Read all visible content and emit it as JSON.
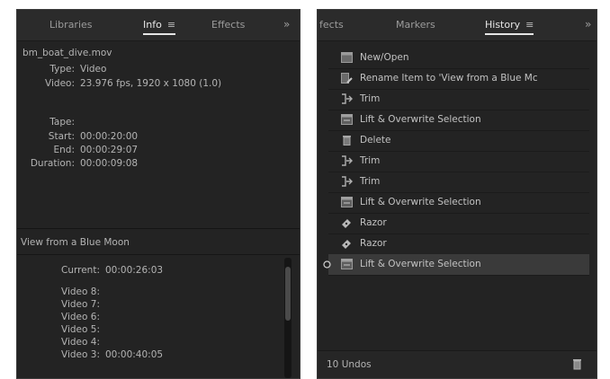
{
  "info_panel": {
    "tabs": [
      {
        "label": "Libraries"
      },
      {
        "label": "Info"
      },
      {
        "label": "Effects"
      }
    ],
    "overflow_glyph": "»",
    "menu_glyph": "≡",
    "clip_name": "bm_boat_dive.mov",
    "clip_fields": [
      {
        "label": "Type:",
        "value": "Video"
      },
      {
        "label": "Video:",
        "value": "23.976 fps, 1920 x 1080 (1.0)"
      }
    ],
    "timing_fields": [
      {
        "label": "Tape:",
        "value": ""
      },
      {
        "label": "Start:",
        "value": "00:00:20:00"
      },
      {
        "label": "End:",
        "value": "00:00:29:07"
      },
      {
        "label": "Duration:",
        "value": "00:00:09:08"
      }
    ],
    "sequence_name": "View from a Blue Moon",
    "current": {
      "label": "Current:",
      "value": "00:00:26:03"
    },
    "video_tracks": [
      {
        "label": "Video 8:",
        "value": ""
      },
      {
        "label": "Video 7:",
        "value": ""
      },
      {
        "label": "Video 6:",
        "value": ""
      },
      {
        "label": "Video 5:",
        "value": ""
      },
      {
        "label": "Video 4:",
        "value": ""
      },
      {
        "label": "Video 3:",
        "value": "00:00:40:05"
      }
    ]
  },
  "history_panel": {
    "tabs": [
      {
        "label": "fects"
      },
      {
        "label": "Markers"
      },
      {
        "label": "History"
      }
    ],
    "overflow_glyph": "»",
    "menu_glyph": "≡",
    "items": [
      {
        "label": "New/Open",
        "icon": "new-open-icon"
      },
      {
        "label": "Rename Item to 'View from a Blue Mc",
        "icon": "rename-icon"
      },
      {
        "label": "Trim",
        "icon": "trim-icon"
      },
      {
        "label": "Lift & Overwrite Selection",
        "icon": "lift-overwrite-icon"
      },
      {
        "label": "Delete",
        "icon": "delete-icon"
      },
      {
        "label": "Trim",
        "icon": "trim-icon"
      },
      {
        "label": "Trim",
        "icon": "trim-icon"
      },
      {
        "label": "Lift & Overwrite Selection",
        "icon": "lift-overwrite-icon"
      },
      {
        "label": "Razor",
        "icon": "razor-icon"
      },
      {
        "label": "Razor",
        "icon": "razor-icon"
      },
      {
        "label": "Lift & Overwrite Selection",
        "icon": "lift-overwrite-icon"
      }
    ],
    "selected_index": 10,
    "undo_count": "10 Undos",
    "trash_icon": "trash-icon"
  }
}
